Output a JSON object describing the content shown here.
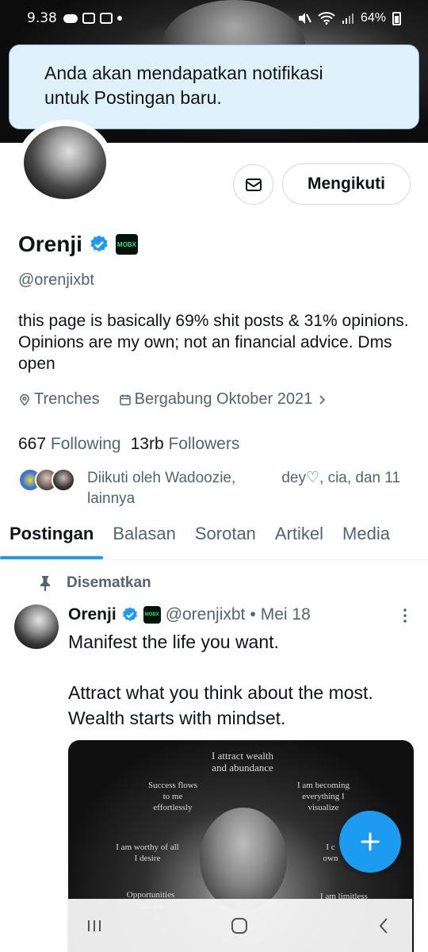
{
  "status_bar": {
    "time": "9.38",
    "battery": "64%"
  },
  "toast": {
    "line1": "Anda akan mendapatkan notifikasi",
    "line2": "untuk Postingan baru."
  },
  "profile": {
    "name": "Orenji",
    "affiliate_badge": "MOBX",
    "handle": "@orenjixbt",
    "bio": "this page is basically 69% shit posts & 31% opinions. Opinions are my own; not an financial advice. Dms open",
    "location": "Trenches",
    "joined": "Bergabung Oktober 2021",
    "following_count": "667",
    "following_label": "Following",
    "followers_count": "13rb",
    "followers_label": "Followers",
    "followed_by": "Diikuti oleh Wadoozie,           dey♡, cia, dan 11 lainnya",
    "follow_button": "Mengikuti"
  },
  "tabs": [
    {
      "label": "Postingan",
      "active": true
    },
    {
      "label": "Balasan",
      "active": false
    },
    {
      "label": "Sorotan",
      "active": false
    },
    {
      "label": "Artikel",
      "active": false
    },
    {
      "label": "Media",
      "active": false
    }
  ],
  "pinned_label": "Disematkan",
  "post": {
    "name": "Orenji",
    "handle": "@orenjixbt",
    "separator": "•",
    "date": "Mei 18",
    "line1": "Manifest the life you want.",
    "line2": "Attract what you think about the most.",
    "line3": "Wealth starts with mindset.",
    "image_text": {
      "t1": "I attract wealth and abundance",
      "t2": "Success flows to me effortlessly",
      "t3": "I am becoming everything I visualize",
      "t4": "I am worthy of all I desire",
      "t5": "I c own",
      "t6": "Opportunities find me",
      "t7": "I am limitless"
    }
  },
  "icons": {
    "mail": "mail-icon",
    "verified": "verified-badge-icon",
    "location": "location-pin-icon",
    "calendar": "calendar-icon",
    "pin": "pin-icon",
    "more": "more-vertical-icon",
    "compose": "plus-icon",
    "nav_recent": "recents-icon",
    "nav_home": "home-icon",
    "nav_back": "back-icon"
  },
  "colors": {
    "accent": "#1d9bf0",
    "toast_bg": "#dff1fb",
    "secondary_text": "#536471"
  }
}
